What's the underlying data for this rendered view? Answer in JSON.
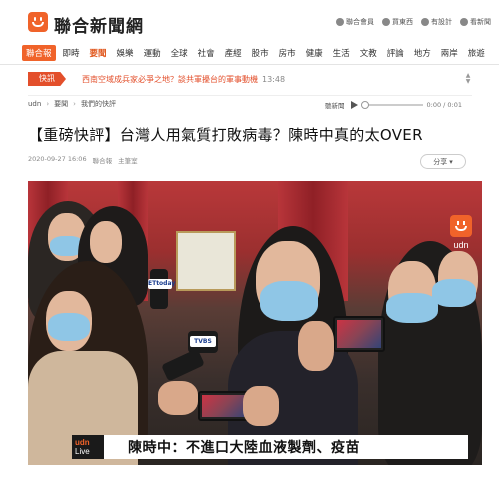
{
  "header": {
    "site_name": "聯合新聞網",
    "links": [
      {
        "label": "聯合會員",
        "icon": "gear-icon"
      },
      {
        "label": "買東西",
        "icon": "bag-icon"
      },
      {
        "label": "有設計",
        "icon": "pen-icon"
      },
      {
        "label": "看新聞",
        "icon": "news-icon"
      }
    ]
  },
  "nav": {
    "brand": "聯合報",
    "items": [
      "即時",
      "要聞",
      "娛樂",
      "運動",
      "全球",
      "社會",
      "產經",
      "股市",
      "房市",
      "健康",
      "生活",
      "文教",
      "評論",
      "地方",
      "兩岸",
      "旅遊"
    ],
    "active_index": 1
  },
  "breaking": {
    "tag": "快訊",
    "text": "西南空域成兵家必爭之地？談共軍擾台的軍事動機",
    "time": "13:48"
  },
  "breadcrumb": [
    "udn",
    "要聞",
    "我們的快評"
  ],
  "audio": {
    "label": "聽新聞",
    "time": "0:00 / 0:01"
  },
  "article": {
    "headline": "【重磅快評】台灣人用氣質打敗病毒？陳時中真的太OVER",
    "date": "2020-09-27 16:06",
    "source": "聯合報",
    "author": "主筆室",
    "share_label": "分享"
  },
  "video": {
    "watermark": "udn",
    "live_label_1": "udn",
    "live_label_2": "Live",
    "caption": "陳時中：不進口大陸血液製劑、疫苗",
    "mic_labels": [
      "ETtoday",
      "TVBS"
    ]
  }
}
